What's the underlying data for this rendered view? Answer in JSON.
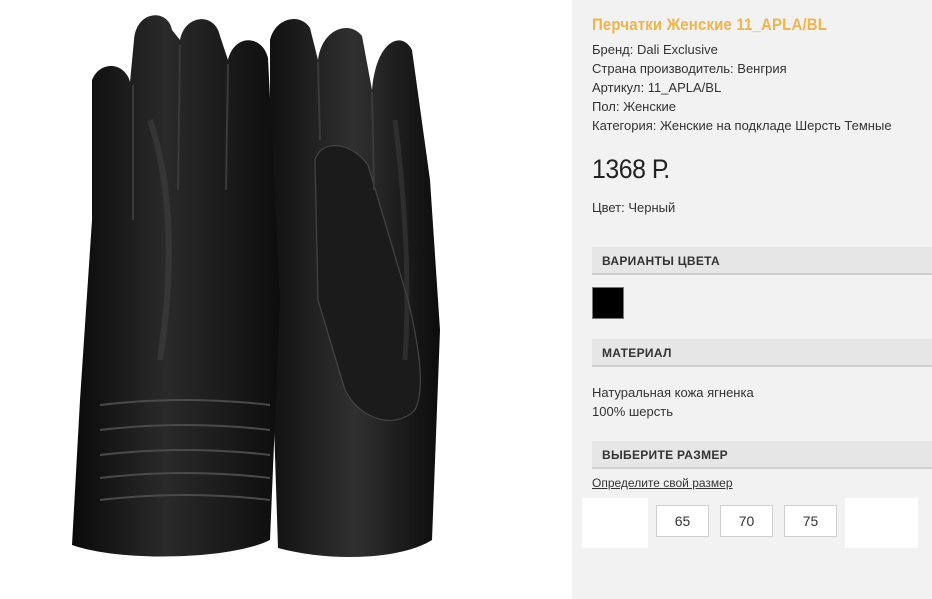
{
  "product": {
    "title": "Перчатки Женские 11_APLA/BL",
    "specs": [
      "Бренд: Dali Exclusive",
      "Страна производитель: Венгрия",
      "Артикул: 11_APLA/BL",
      "Пол: Женские",
      "Категория: Женские на подкладе Шерсть Темные"
    ],
    "price": "1368 Р.",
    "color_line": "Цвет: Черный"
  },
  "sections": {
    "color_variants": "ВАРИАНТЫ ЦВЕТА",
    "material": "МАТЕРИАЛ",
    "size": "ВЫБЕРИТЕ РАЗМЕР"
  },
  "swatch": {
    "color": "#000000",
    "icon": "color-swatch-black"
  },
  "material_lines": [
    "Натуральная кожа ягненка",
    "100% шерсть"
  ],
  "size_link": "Определите свой размер",
  "sizes": [
    "65",
    "70",
    "75"
  ],
  "colors": {
    "title": "#f0b44a",
    "section_bg": "#e6e6e6",
    "page_bg": "#f2f2f2",
    "glove": "#141414"
  },
  "image": {
    "icon": "product-photo-leather-gloves"
  }
}
